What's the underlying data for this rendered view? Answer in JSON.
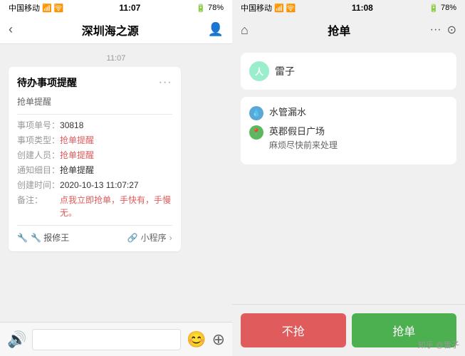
{
  "left_phone": {
    "status_bar": {
      "carrier": "中国移动",
      "wifi": "WiFi",
      "time": "11:07",
      "battery_icon": "🔋",
      "battery": "78%",
      "charge": "⚡"
    },
    "nav": {
      "back_icon": "‹",
      "title": "深圳海之源",
      "person_icon": "👤"
    },
    "timestamp": "11:07",
    "message": {
      "title": "待办事项提醒",
      "dots": "···",
      "subtitle": "抢单提醒",
      "fields": [
        {
          "label": "事项单号：",
          "value": "30818",
          "color": "normal"
        },
        {
          "label": "事项类型：",
          "value": "抢单提醒",
          "color": "red"
        },
        {
          "label": "创建人员：",
          "value": "抢单提醒",
          "color": "red"
        },
        {
          "label": "通知细目：",
          "value": "抢单提醒",
          "color": "normal"
        },
        {
          "label": "创建时间：",
          "value": "2020-10-13 11:07:27",
          "color": "normal"
        },
        {
          "label": "备注：",
          "value": "点我立即抢单，手快有，手慢无。",
          "color": "red"
        }
      ],
      "footer_left": "🔧 报修王",
      "footer_right": "小程序",
      "footer_arrow": "›"
    },
    "input_bar": {
      "voice_icon": "🔊",
      "emoji_icon": "😊",
      "plus_icon": "⊕"
    }
  },
  "right_phone": {
    "status_bar": {
      "carrier": "中国移动",
      "wifi": "WiFi",
      "time": "11:08",
      "battery": "78%"
    },
    "nav": {
      "home_icon": "⌂",
      "title": "抢单",
      "more_icon": "···",
      "circle_icon": "⊙"
    },
    "person": {
      "avatar_text": "人",
      "name": "雷子"
    },
    "info": {
      "item1_icon": "💧",
      "item1_title": "水管漏水",
      "item2_icon": "📍",
      "item2_location": "英郡假日广场",
      "item2_desc": "麻烦尽快前来处理"
    },
    "buttons": {
      "reject": "不抢",
      "accept": "抢单"
    }
  },
  "watermark": "知乎 @雷子"
}
